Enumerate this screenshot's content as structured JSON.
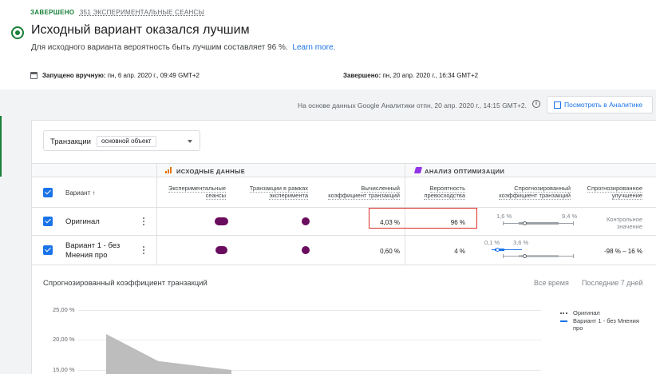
{
  "header": {
    "status": "ЗАВЕРШЕНО",
    "sessions": "351 ЭКСПЕРИМЕНТАЛЬНЫЕ СЕАНСЫ",
    "title": "Исходный вариант оказался лучшим",
    "subtitle": "Для исходного варианта вероятность быть лучшим составляет 96 %.",
    "learn_more": "Learn more.",
    "started_label": "Запущено вручную:",
    "started_value": "пн, 6 апр. 2020 г., 09:49 GMT+2",
    "ended_label": "Завершено:",
    "ended_value": "пн, 20 апр. 2020 г., 16:34 GMT+2"
  },
  "ga": {
    "note": "На основе данных Google Аналитики отпн, 20 апр. 2020 г., 14:15 GMT+2.",
    "button": "Посмотреть в Аналитике"
  },
  "objective": {
    "label": "Транзакции",
    "chip": "основной объект"
  },
  "groups": {
    "source": "ИСХОДНЫЕ ДАННЫЕ",
    "optimize": "АНАЛИЗ ОПТИМИЗАЦИИ"
  },
  "columns": {
    "variant": "Вариант",
    "sort_arrow": "↑",
    "sessions": [
      "Экспериментальные",
      "сеансы"
    ],
    "transactions": [
      "Транзакции в рамках",
      "эксперимента"
    ],
    "conv_rate": [
      "Вычисленный",
      "коэффициент транзакций"
    ],
    "prob_best": [
      "Вероятность",
      "превосходства"
    ],
    "modeled_rate": [
      "Спрогнозированный",
      "коэффициент транзакций"
    ],
    "modeled_improvement": [
      "Спрогнозированное",
      "улучшение"
    ]
  },
  "rows": [
    {
      "name": "Оригинал",
      "conv_rate": "4,03 %",
      "prob_best": "96 %",
      "range_low": "1,6 %",
      "range_high": "9,4 %",
      "improvement": [
        "Контрольное",
        "значение"
      ]
    },
    {
      "name": [
        "Вариант 1 - без",
        "Мнения про"
      ],
      "conv_rate": "0,60 %",
      "prob_best": "4 %",
      "range_low": "0,1 %",
      "range_high": "3,6 %",
      "improvement": "-98 % – 16 %"
    }
  ],
  "chart": {
    "title": "Спрогнозированный коэффициент транзакций",
    "range_all": "Все время",
    "range_7d": "Последние 7 дней",
    "legend": [
      "Оригинал",
      "Вариант 1 - без Мнения",
      "про"
    ],
    "colors": {
      "original": "#5f6368",
      "variant": "#1a73e8",
      "fill": "#bdbdbd"
    }
  },
  "chart_data": {
    "type": "area",
    "title": "Спрогнозированный коэффициент транзакций",
    "y_ticks": [
      "25,00 %",
      "20,00 %",
      "15,00 %"
    ],
    "series": [
      {
        "name": "Оригинал",
        "values": [
          21.0,
          16.5,
          15.0
        ]
      }
    ]
  }
}
